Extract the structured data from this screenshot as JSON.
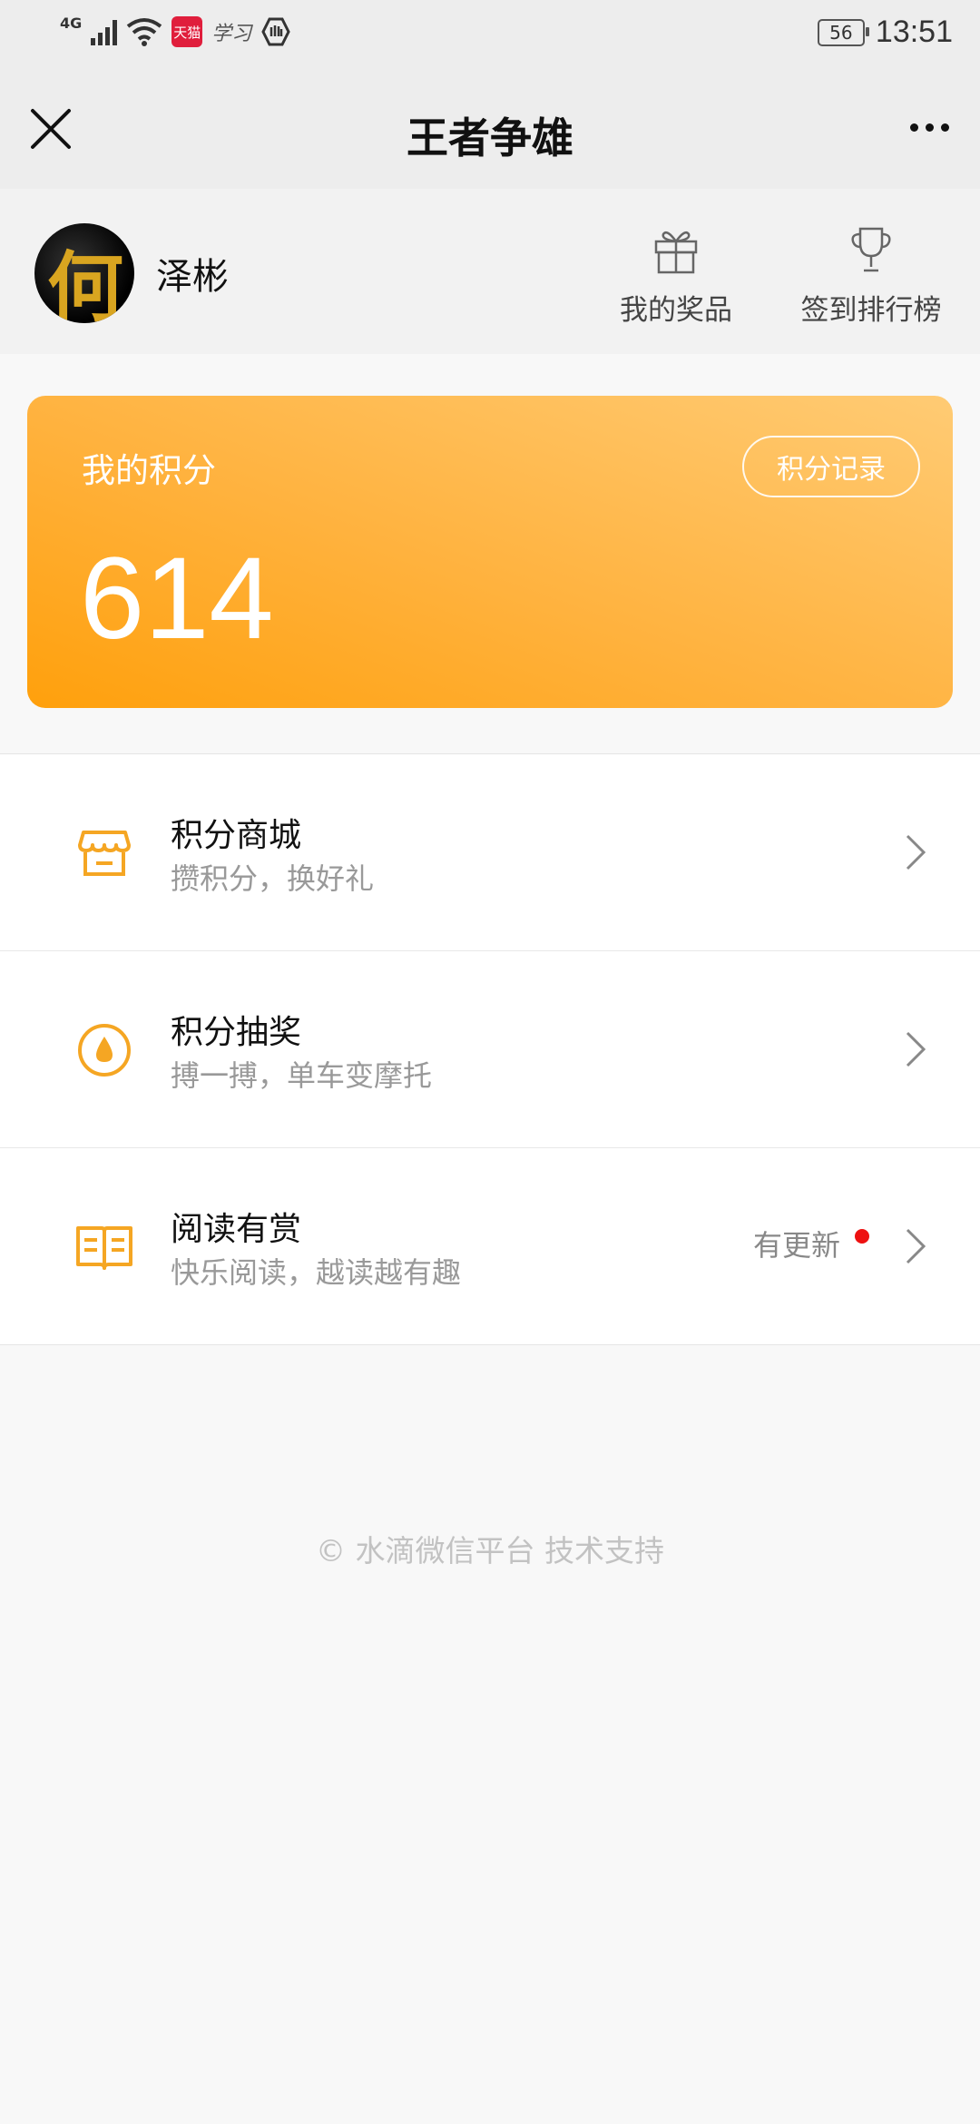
{
  "status_bar": {
    "network": "4G",
    "tmall_label": "天猫",
    "study_label": "学习",
    "battery": "56",
    "time": "13:51"
  },
  "nav": {
    "title": "王者争雄"
  },
  "user": {
    "avatar_glyph": "何",
    "name": "泽彬",
    "prizes_label": "我的奖品",
    "rank_label": "签到排行榜"
  },
  "points_card": {
    "label": "我的积分",
    "value": "614",
    "records_button": "积分记录"
  },
  "menu": [
    {
      "title": "积分商城",
      "subtitle": "攒积分，换好礼",
      "icon": "shop-icon"
    },
    {
      "title": "积分抽奖",
      "subtitle": "搏一搏，单车变摩托",
      "icon": "lottery-drop-icon"
    },
    {
      "title": "阅读有赏",
      "subtitle": "快乐阅读，越读越有趣",
      "icon": "book-icon",
      "badge": "有更新"
    }
  ],
  "footer": "© 水滴微信平台 技术支持",
  "colors": {
    "accent": "#f5a623",
    "card_start": "#ffa00c",
    "card_end": "#ffcb74",
    "badge_dot": "#e11111"
  }
}
